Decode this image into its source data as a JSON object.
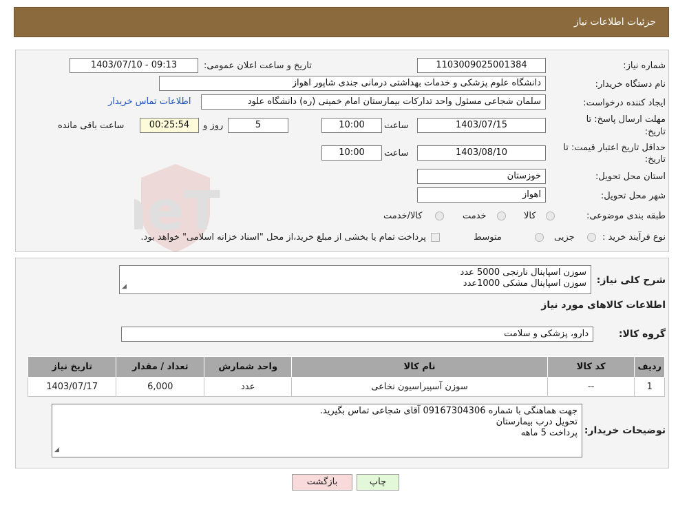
{
  "header": {
    "title": "جزئیات اطلاعات نیاز"
  },
  "form": {
    "need_number_label": "شماره نیاز:",
    "need_number": "1103009025001384",
    "announce_label": "تاریخ و ساعت اعلان عمومی:",
    "announce_value": "1403/07/10 - 09:13",
    "buyer_org_label": "نام دستگاه خریدار:",
    "buyer_org": "دانشگاه علوم پزشکی و خدمات بهداشتی درمانی جندی شاپور اهواز",
    "requester_label": "ایجاد کننده درخواست:",
    "requester": "سلمان شجاعی مسئول واحد تدارکات بیمارستان امام خمینی (ره) دانشگاه علود",
    "buyer_contact_link": "اطلاعات تماس خریدار",
    "deadline_label_1": "مهلت ارسال پاسخ: تا",
    "deadline_label_2": "تاریخ:",
    "deadline_date": "1403/07/15",
    "time_label": "ساعت",
    "deadline_time": "10:00",
    "days_value": "5",
    "days_label": "روز و",
    "remaining_time": "00:25:54",
    "remaining_label": "ساعت باقی مانده",
    "validity_label_1": "حداقل تاریخ اعتبار قیمت: تا",
    "validity_label_2": "تاریخ:",
    "validity_date": "1403/08/10",
    "validity_time": "10:00",
    "province_label": "استان محل تحویل:",
    "province": "خوزستان",
    "city_label": "شهر محل تحویل:",
    "city": "اهواز",
    "category_label": "طبقه بندی موضوعی:",
    "category_options": [
      "کالا",
      "خدمت",
      "کالا/خدمت"
    ],
    "process_label": "نوع فرآیند خرید :",
    "process_options": [
      "جزیی",
      "متوسط"
    ],
    "payment_note": "پرداخت تمام یا بخشی از مبلغ خرید،از محل \"اسناد خزانه اسلامی\" خواهد بود."
  },
  "details": {
    "description_label": "شرح کلی نیاز:",
    "description_lines": [
      "سوزن اسپاینال نارنجی 5000 عدد",
      "سوزن اسپاینال مشکی 1000عدد"
    ],
    "goods_info_title": "اطلاعات کالاهای مورد نیاز",
    "goods_group_label": "گروه کالا:",
    "goods_group": "دارو، پزشکی و سلامت",
    "table_headers": [
      "ردیف",
      "کد کالا",
      "نام کالا",
      "واحد شمارش",
      "تعداد / مقدار",
      "تاریخ نیاز"
    ],
    "table_rows": [
      [
        "1",
        "--",
        "سوزن آسپیراسیون نخاعی",
        "عدد",
        "6,000",
        "1403/07/17"
      ]
    ],
    "buyer_notes_label": "توضیحات خریدار:",
    "buyer_notes_lines": [
      "جهت هماهنگی با شماره 09167304306 آقای شجاعی تماس بگیرید.",
      "تحویل درب بیمارستان",
      "پرداخت 5 ماهه"
    ]
  },
  "buttons": {
    "print": "چاپ",
    "back": "بازگشت"
  },
  "watermark": {
    "text": "AriaTender.neT"
  },
  "colors": {
    "header_bg": "#8b6a3e",
    "remaining_bg": "#fdfbd9",
    "back_button_bg": "#f8dada",
    "print_button_bg": "#e3f8d9",
    "table_header_bg": "#a9a9a9"
  }
}
